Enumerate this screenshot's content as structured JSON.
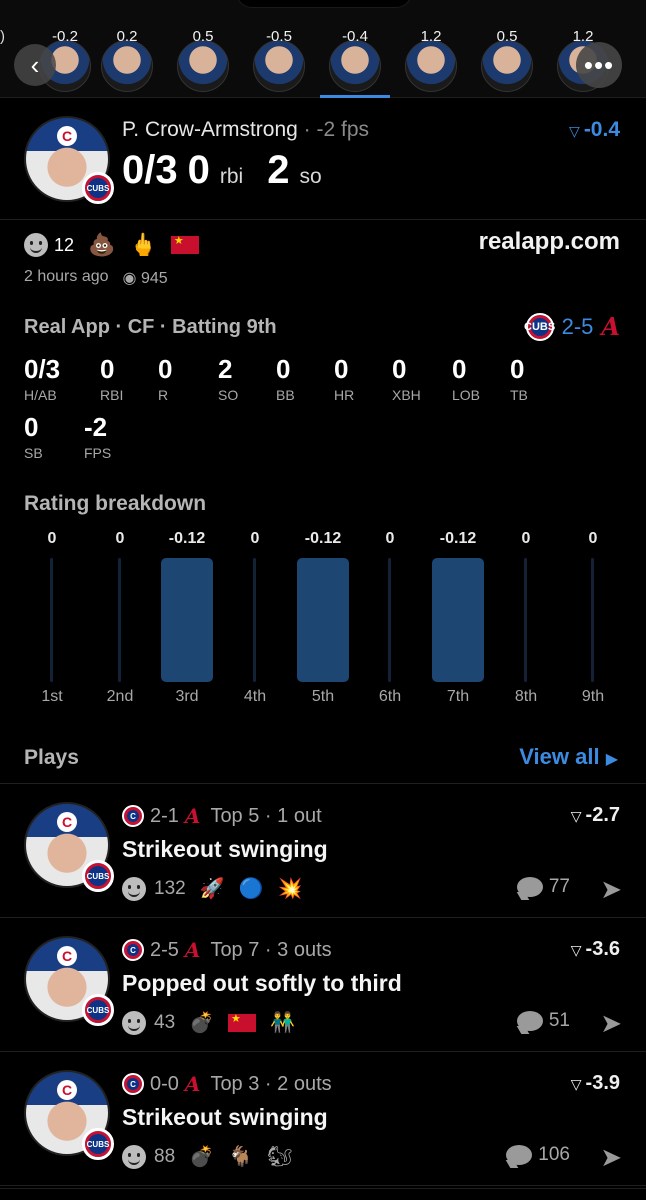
{
  "strip": {
    "ratings": [
      "-0.2",
      "0.2",
      "0.5",
      "-0.5",
      "-0.4",
      "1.2",
      "0.5",
      "1.2"
    ],
    "active_index": 4,
    "edge_fragment": ")"
  },
  "header": {
    "player": "P. Crow-Armstrong",
    "dot": "·",
    "fps": "-2 fps",
    "rating": "-0.4",
    "hits": "0/3",
    "rbi_value": "0",
    "rbi_unit": "rbi",
    "so_value": "2",
    "so_unit": "so"
  },
  "reactions": {
    "count": "12",
    "emojis": [
      "💩",
      "🖕"
    ],
    "site": "realapp.com",
    "time": "2 hours ago",
    "views": "945"
  },
  "game": {
    "title": "Real App · CF · Batting 9th",
    "score": "2-5",
    "stats": [
      {
        "v": "0/3",
        "l": "H/AB"
      },
      {
        "v": "0",
        "l": "RBI"
      },
      {
        "v": "0",
        "l": "R"
      },
      {
        "v": "2",
        "l": "SO"
      },
      {
        "v": "0",
        "l": "BB"
      },
      {
        "v": "0",
        "l": "HR"
      },
      {
        "v": "0",
        "l": "XBH"
      },
      {
        "v": "0",
        "l": "LOB"
      },
      {
        "v": "0",
        "l": "TB"
      },
      {
        "v": "0",
        "l": "SB"
      },
      {
        "v": "-2",
        "l": "FPS"
      }
    ]
  },
  "breakdown": {
    "title": "Rating breakdown",
    "innings": [
      {
        "label": "1st",
        "value": "0"
      },
      {
        "label": "2nd",
        "value": "0"
      },
      {
        "label": "3rd",
        "value": "-0.12"
      },
      {
        "label": "4th",
        "value": "0"
      },
      {
        "label": "5th",
        "value": "-0.12"
      },
      {
        "label": "6th",
        "value": "0"
      },
      {
        "label": "7th",
        "value": "-0.12"
      },
      {
        "label": "8th",
        "value": "0"
      },
      {
        "label": "9th",
        "value": "0"
      }
    ]
  },
  "plays": {
    "title": "Plays",
    "view_all": "View all",
    "items": [
      {
        "score": "2-1",
        "inning": "Top 5 · 1 out",
        "delta": "-2.7",
        "desc": "Strikeout swinging",
        "reacts": "132",
        "emojis": [
          "🚀",
          "🔵",
          "💥"
        ],
        "comments": "77"
      },
      {
        "score": "2-5",
        "inning": "Top 7 · 3 outs",
        "delta": "-3.6",
        "desc": "Popped out softly to third",
        "reacts": "43",
        "emojis": [
          "💣",
          "🇨🇳",
          "👬"
        ],
        "comments": "51"
      },
      {
        "score": "0-0",
        "inning": "Top 3 · 2 outs",
        "delta": "-3.9",
        "desc": "Strikeout swinging",
        "reacts": "88",
        "emojis": [
          "💣",
          "🐐",
          "🐿"
        ],
        "comments": "106"
      }
    ]
  },
  "colors": {
    "accent": "#3c8be0",
    "bar": "#1d4673",
    "cubs_blue": "#0e3386",
    "cubs_red": "#c9102e"
  }
}
